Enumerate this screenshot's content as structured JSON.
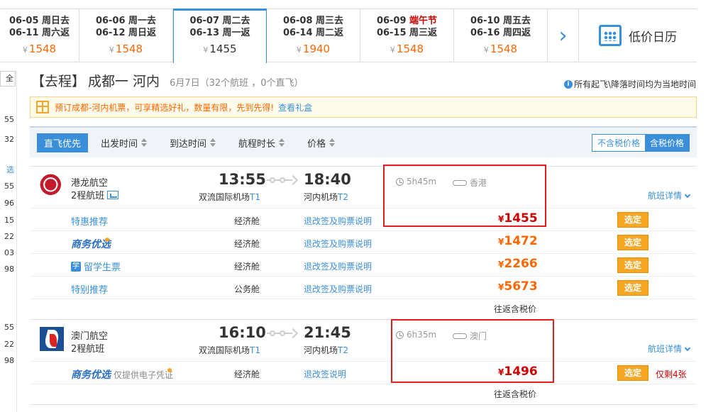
{
  "date_tabs": [
    {
      "line1": "06-05 周日去",
      "line2": "06-11 周六返",
      "price": "1548",
      "holiday": false,
      "active": false
    },
    {
      "line1": "06-06 周一去",
      "line2": "06-12 周日返",
      "price": "1548",
      "holiday": false,
      "active": false
    },
    {
      "line1": "06-07 周二去",
      "line2": "06-13 周一返",
      "price": "1455",
      "holiday": false,
      "active": true
    },
    {
      "line1": "06-08 周三去",
      "line2": "06-14 周二返",
      "price": "1940",
      "holiday": false,
      "active": false
    },
    {
      "line1_pre": "06-09 ",
      "line1_holiday": "端午节",
      "line2": "06-15 周三返",
      "price": "1548",
      "holiday": true,
      "active": false
    },
    {
      "line1": "06-10 周五去",
      "line2": "06-16 周四返",
      "price": "1548",
      "holiday": false,
      "active": false
    }
  ],
  "yen": "¥",
  "low_calendar": "低价日历",
  "left_stub": {
    "btn": "全部",
    "times": [
      "55",
      "32",
      "选",
      "55",
      "96",
      "15",
      "22",
      "03",
      "98",
      "55",
      "22",
      "98"
    ]
  },
  "heading": {
    "trip": "【去程】",
    "route": "成都一 河内",
    "sub": "6月7日（32个航班 ，0个直飞）"
  },
  "tz_note": "所有起飞\\降落时间均为当地时间",
  "promo": {
    "text": "预订成都-河内机票，可享精选好礼，数量有限，先到先得!",
    "link": "查看礼盒"
  },
  "sortbar": {
    "items": [
      "直飞优先",
      "出发时间",
      "到达时间",
      "航程时长",
      "价格"
    ],
    "toggle": [
      "不含税价格",
      "含税价格"
    ]
  },
  "flights": [
    {
      "airline": "港龙航空",
      "type": "2程航班",
      "dep_time": "13:55",
      "arr_time": "18:40",
      "dep_airport": "双流国际机场",
      "dep_term": "T1",
      "arr_airport": "河内机场",
      "arr_term": "T2",
      "duration": "5h45m",
      "stop": "香港",
      "detail": "航班详情",
      "fares": [
        {
          "label": "特惠推荐",
          "cabin": "经济舱",
          "refund": "退改签及购票说明",
          "price": "1455",
          "select": "选定"
        },
        {
          "label": "商务优选",
          "cabin": "经济舱",
          "refund": "退改签及购票说明",
          "price": "1472",
          "select": "选定"
        },
        {
          "label": "留学生票",
          "stu_icon": "学",
          "cabin": "经济舱",
          "refund": "退改签及购票说明",
          "price": "2266",
          "select": "选定"
        },
        {
          "label": "特别推荐",
          "cabin": "公务舱",
          "refund": "退改签及购票说明",
          "price": "5673",
          "select": "选定"
        }
      ],
      "foot": "往返含税价"
    },
    {
      "airline": "澳门航空",
      "type": "2程航班",
      "dep_time": "16:10",
      "arr_time": "21:45",
      "dep_airport": "双流国际机场",
      "dep_term": "T1",
      "arr_airport": "河内机场",
      "arr_term": "T2",
      "duration": "6h35m",
      "stop": "澳门",
      "detail": "航班详情",
      "fares": [
        {
          "label": "商务优选",
          "note": "仅提供电子凭证",
          "cabin": "经济舱",
          "refund": "退改签说明",
          "price": "1496",
          "select": "选定",
          "remain": "仅剩4张"
        }
      ],
      "foot": "往返含税价"
    }
  ],
  "colors": {
    "accent": "#3b8fd8",
    "price": "#ff6600",
    "select": "#f5a623",
    "highlight": "#e02020"
  }
}
